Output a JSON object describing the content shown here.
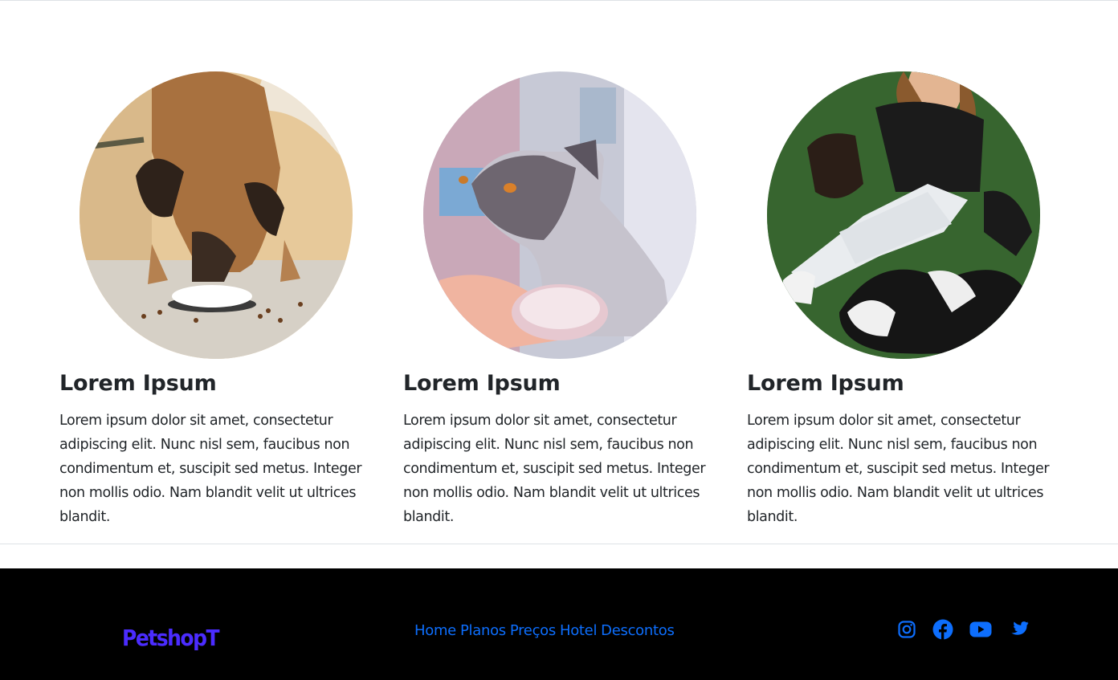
{
  "cards": [
    {
      "title": "Lorem Ipsum",
      "text": "Lorem ipsum dolor sit amet, consectetur adipiscing elit. Nunc nisl sem, faucibus non condimentum et, suscipit sed metus. Integer non mollis odio. Nam blandit velit ut ultrices blandit."
    },
    {
      "title": "Lorem Ipsum",
      "text": "Lorem ipsum dolor sit amet, consectetur adipiscing elit. Nunc nisl sem, faucibus non condimentum et, suscipit sed metus. Integer non mollis odio. Nam blandit velit ut ultrices blandit."
    },
    {
      "title": "Lorem Ipsum",
      "text": "Lorem ipsum dolor sit amet, consectetur adipiscing elit. Nunc nisl sem, faucibus non condimentum et, suscipit sed metus. Integer non mollis odio. Nam blandit velit ut ultrices blandit."
    }
  ],
  "footer": {
    "brand": "PetshopT",
    "nav": [
      "Home",
      "Planos",
      "Preços",
      "Hotel",
      "Descontos"
    ],
    "socials": [
      "instagram-icon",
      "facebook-icon",
      "youtube-icon",
      "twitter-icon"
    ]
  },
  "colors": {
    "footer_bg": "#000000",
    "link": "#0d6efd",
    "brand": "#4b2cff",
    "text": "#212529"
  }
}
